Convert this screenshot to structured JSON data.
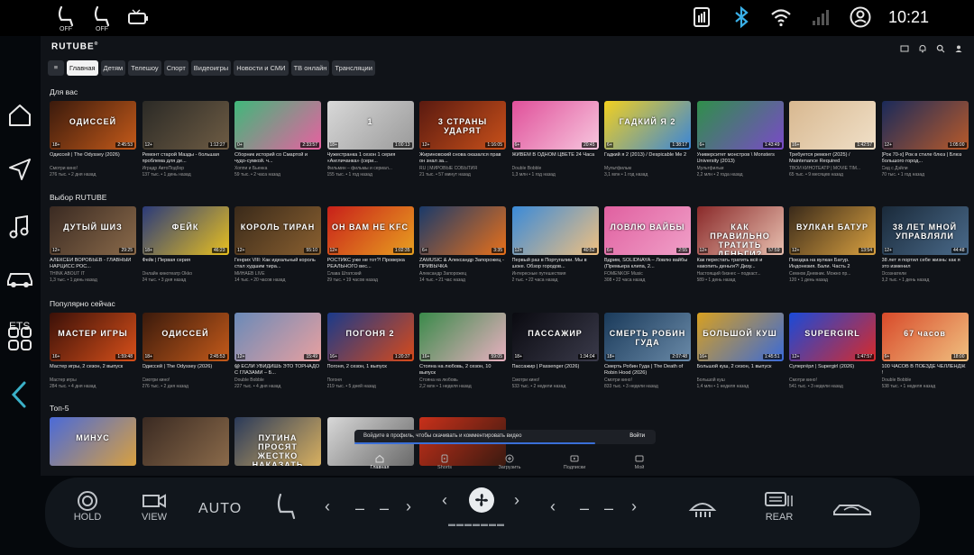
{
  "status_bar": {
    "seat_heat_left": "OFF",
    "seat_heat_right": "OFF",
    "time": "10:21"
  },
  "dock": {
    "ets_label": "ETS"
  },
  "rutube": {
    "logo": "RUTUBE",
    "categories": [
      "Главная",
      "Детям",
      "Телешоу",
      "Спорт",
      "Видеоигры",
      "Новости и СМИ",
      "ТВ онлайн",
      "Трансляции"
    ],
    "active_category": "Главная",
    "sections": [
      {
        "title": "Для вас",
        "cards": [
          {
            "title": "Одиссей | The Odyssey (2026)",
            "channel": "Смотри кино!",
            "stats": "276 тыс. • 2 дня назад",
            "age": "18+",
            "duration": "2:45:53",
            "overlay": "ОДИССЕЙ",
            "color1": "#3a1a0c",
            "color2": "#c45a1a"
          },
          {
            "title": "Ремонт старой Мазды - большая проблема для де...",
            "channel": "Иградр АвтоПодбор",
            "stats": "137 тыс. • 1 день назад",
            "age": "12+",
            "duration": "1:12:27",
            "overlay": "",
            "color1": "#2b2a26",
            "color2": "#6e5c44"
          },
          {
            "title": "Сборник историй со Смартой и чудо-сумкой. ч...",
            "channel": "Хоппи и Бьенка",
            "stats": "59 тыс. • 2 часа назад",
            "age": "0+",
            "duration": "2:33:57",
            "overlay": "",
            "color1": "#3fb87a",
            "color2": "#e860a0"
          },
          {
            "title": "Чужестранка 1 сезон 1 серия «Англичанка» (сери...",
            "channel": "Фильмин – фильмы и сериал...",
            "stats": "155 тыс. • 1 год назад",
            "age": "18+",
            "duration": "1:00:13",
            "overlay": "1",
            "color1": "#d8d8d8",
            "color2": "#9a9a9a"
          },
          {
            "title": "Жириновский снова оказался прав он знал за...",
            "channel": "RU | МИРОВЫЕ СОБЫТИЯ",
            "stats": "21 тыс. • 57 минут назад",
            "age": "12+",
            "duration": "1:16:05",
            "overlay": "3 СТРАНЫ УДАРЯТ",
            "color1": "#5a1a10",
            "color2": "#c8501a"
          },
          {
            "title": "ЖИВЕМ В ОДНОМ ЦВЕТЕ 24 Часа",
            "channel": "Double Bobble",
            "stats": "1,3 млн • 1 год назад",
            "age": "6+",
            "duration": "20:45",
            "overlay": "",
            "color1": "#e0509a",
            "color2": "#f7c6de"
          },
          {
            "title": "Гадкий я 2 (2013) / Despicable Me 2",
            "channel": "Мультфильм",
            "stats": "3,1 млн • 1 год назад",
            "age": "6+",
            "duration": "1:38:17",
            "overlay": "ГАДКИЙ Я 2",
            "color1": "#f2d020",
            "color2": "#3a86d8"
          },
          {
            "title": "Университет монстров \\ Monsters University (2013)",
            "channel": "Мультфильм",
            "stats": "2,2 млн • 2 года назад",
            "age": "6+",
            "duration": "1:43:49",
            "overlay": "",
            "color1": "#2f8f4a",
            "color2": "#7a4ac8"
          },
          {
            "title": "Требуется ремонт (2025) / Maintenance Required",
            "channel": "ТВОЙ КИНОТЕАТР | MOVIE TIM...",
            "stats": "65 тыс. • 9 месяцев назад",
            "age": "16+",
            "duration": "1:42:57",
            "overlay": "",
            "color1": "#d8b890",
            "color2": "#f0e0c8"
          },
          {
            "title": "[Рок 70-х] Рок в стиле блюз | Блюз большого город...",
            "channel": "Сид с Дэйли",
            "stats": "70 тыс. • 1 год назад",
            "age": "12+",
            "duration": "1:05:00",
            "overlay": "",
            "color1": "#1a2a5a",
            "color2": "#b85a2a"
          }
        ]
      },
      {
        "title": "Выбор RUTUBE",
        "cards": [
          {
            "title": "АЛЕКСЕЙ ВОРОБЬЁВ - ГЛАВНЫЙ НАРЦИСС РОС...",
            "channel": "THINK ABOUT IT",
            "stats": "1,3 тыс. • 1 день назад",
            "age": "12+",
            "duration": "29:25",
            "overlay": "ДУТЫЙ ШИЗ",
            "color1": "#3a2a22",
            "color2": "#8a6a4a"
          },
          {
            "title": "Фейк | Первая серия",
            "channel": "Онлайн кинотеатр Okko",
            "stats": "24 тыс. • 3 дня назад",
            "age": "18+",
            "duration": "46:23",
            "overlay": "ФЕЙК",
            "color1": "#2a3a7a",
            "color2": "#e8c020"
          },
          {
            "title": "Генрих VIII: Как идеальный король стал худшим тира...",
            "channel": "МИНАЕВ LIVE",
            "stats": "14 тыс. • 20 часов назад",
            "age": "12+",
            "duration": "55:10",
            "overlay": "КОРОЛЬ ТИРАН",
            "color1": "#3a2a1a",
            "color2": "#8a6030"
          },
          {
            "title": "РОСТИКС уже не тот?! Проверка РЕАЛЬНОГО вес...",
            "channel": "Слава Штатский",
            "stats": "29 тыс. • 19 часов назад",
            "age": "12+",
            "duration": "1:02:35",
            "overlay": "ОН ВАМ НЕ KFC",
            "color1": "#c8201a",
            "color2": "#e8a020"
          },
          {
            "title": "ZAMUSIC & Александр Запорожец - ПРИВЫЧКА",
            "channel": "Александр Запорожец",
            "stats": "14 тыс. • 21 час назад",
            "age": "6+",
            "duration": "3:35",
            "overlay": "",
            "color1": "#1a3a6a",
            "color2": "#e8701a"
          },
          {
            "title": "Первый раз в Португалии. Мы в шоке. Обзор городов...",
            "channel": "Интересные путешествия",
            "stats": "2 тыс. • 22 часа назад",
            "age": "12+",
            "duration": "40:52",
            "overlay": "",
            "color1": "#3a8ad8",
            "color2": "#f0c080"
          },
          {
            "title": "Вдрим, SOLIDNAYA – Ловлю вайбы (Премьера клипа, 2...",
            "channel": "FOMENKOF Music",
            "stats": "308 • 22 часа назад",
            "age": "6+",
            "duration": "2:55",
            "overlay": "ЛОВЛЮ ВАЙБЫ",
            "color1": "#e060a0",
            "color2": "#f0a0c8"
          },
          {
            "title": "Как перестать тратить всё и накопить деньги?! Дизу...",
            "channel": "Настоящий бизнес – подкаст...",
            "stats": "589 • 1 день назад",
            "age": "12+",
            "duration": "57:59",
            "overlay": "КАК ПРАВИЛЬНО ТРАТИТЬ ДЕНЬГИ?",
            "color1": "#8a2a2a",
            "color2": "#e8c0b0"
          },
          {
            "title": "Поездка на вулкан Батур. Индонезия. Бали. Часть 2",
            "channel": "Семнов Дневник. Можно пр...",
            "stats": "120 • 1 день назад",
            "age": "12+",
            "duration": "13:54",
            "overlay": "ВУЛКАН БАТУР",
            "color1": "#3a2a1a",
            "color2": "#d8a040"
          },
          {
            "title": "38 лет я портил себе жизнь: как я это изменил",
            "channel": "Осознатели",
            "stats": "3,2 тыс. • 1 день назад",
            "age": "12+",
            "duration": "44:48",
            "overlay": "38 ЛЕТ МНОЙ УПРАВЛЯЛИ",
            "color1": "#1a2a3a",
            "color2": "#4a6a8a"
          }
        ]
      },
      {
        "title": "Популярно сейчас",
        "cards": [
          {
            "title": "Мастер игры, 2 сезон, 2 выпуск",
            "channel": "Мастер игры",
            "stats": "284 тыс. • 4 дня назад",
            "age": "16+",
            "duration": "1:59:48",
            "overlay": "МАСТЕР ИГРЫ",
            "color1": "#3a1008",
            "color2": "#d8501a"
          },
          {
            "title": "Одиссей | The Odyssey (2026)",
            "channel": "Смотри кино!",
            "stats": "276 тыс. • 2 дня назад",
            "age": "18+",
            "duration": "2:45:53",
            "overlay": "ОДИССЕЙ",
            "color1": "#3a1a0c",
            "color2": "#c45a1a"
          },
          {
            "title": "😱 ЕСЛИ УВИДИШЬ ЭТО ТОРНАДО С ГЛАЗАМИ – Б...",
            "channel": "Double Bobble",
            "stats": "227 тыс. • 4 дня назад",
            "age": "12+",
            "duration": "15:49",
            "overlay": "",
            "color1": "#6a8ab8",
            "color2": "#e8a0a0"
          },
          {
            "title": "Погоня, 2 сезон, 1 выпуск",
            "channel": "Погоня",
            "stats": "219 тыс. • 5 дней назад",
            "age": "16+",
            "duration": "1:20:37",
            "overlay": "ПОГОНЯ 2",
            "color1": "#1a3a8a",
            "color2": "#d84a1a"
          },
          {
            "title": "Стояна на любовь, 2 сезон, 10 выпуск",
            "channel": "Стояна на любовь",
            "stats": "2,2 млн • 1 неделя назад",
            "age": "16+",
            "duration": "59:05",
            "overlay": "",
            "color1": "#3a8a4a",
            "color2": "#e8b0c0"
          },
          {
            "title": "Пассажир | Passenger (2026)",
            "channel": "Смотри кино!",
            "stats": "533 тыс. • 2 недели назад",
            "age": "18+",
            "duration": "1:34:04",
            "overlay": "ПАССАЖИР",
            "color1": "#0a0a10",
            "color2": "#3a3a4a"
          },
          {
            "title": "Смерть Робин Гуда | The Death of Robin Hood (2026)",
            "channel": "Смотри кино!",
            "stats": "833 тыс. • 3 недели назад",
            "age": "18+",
            "duration": "2:07:48",
            "overlay": "СМЕРТЬ РОБИН ГУДА",
            "color1": "#1a3a5a",
            "color2": "#6a8aa8"
          },
          {
            "title": "Большой куш, 2 сезон, 1 выпуск",
            "channel": "Большой куш",
            "stats": "1,4 млн • 1 неделя назад",
            "age": "16+",
            "duration": "1:45:51",
            "overlay": "БОЛЬШОЙ КУШ",
            "color1": "#d8a020",
            "color2": "#3a6ad8"
          },
          {
            "title": "Супергёрл | Supergirl (2026)",
            "channel": "Смотри кино!",
            "stats": "541 тыс. • 3 недели назад",
            "age": "12+",
            "duration": "1:47:57",
            "overlay": "SUPERGIRL",
            "color1": "#1a4ad8",
            "color2": "#d82a2a"
          },
          {
            "title": "100 ЧАСОВ В ПОЕЗДЕ ЧЕЛЛЕНДЖ !",
            "channel": "Double Bobble",
            "stats": "538 тыс. • 1 неделя назад",
            "age": "6+",
            "duration": "18:00",
            "overlay": "67 часов",
            "color1": "#d84a2a",
            "color2": "#f0c080"
          }
        ]
      },
      {
        "title": "Топ-5",
        "cards": [
          {
            "title": "",
            "channel": "",
            "stats": "",
            "age": "",
            "duration": "",
            "overlay": "МИНУС",
            "color1": "#4a6ad8",
            "color2": "#d8a040"
          },
          {
            "title": "",
            "channel": "",
            "stats": "",
            "age": "",
            "duration": "",
            "overlay": "",
            "color1": "#3a2a22",
            "color2": "#8a6a4a"
          },
          {
            "title": "",
            "channel": "",
            "stats": "",
            "age": "",
            "duration": "",
            "overlay": "ПУТИНА ПРОСЯТ ЖЕСТКО НАКАЗАТЬ НАТО",
            "color1": "#2a3a5a",
            "color2": "#d8b060"
          },
          {
            "title": "",
            "channel": "",
            "stats": "",
            "age": "",
            "duration": "",
            "overlay": "",
            "color1": "#d8d8d8",
            "color2": "#6a6a6a"
          },
          {
            "title": "",
            "channel": "",
            "stats": "",
            "age": "",
            "duration": "",
            "overlay": "",
            "color1": "#c8301a",
            "color2": "#3a1a10"
          }
        ]
      }
    ],
    "toast": {
      "message": "Войдите в профиль, чтобы скачивать и комментировать видео",
      "action": "Войти",
      "progress": 0.8
    },
    "bottom_nav": [
      {
        "label": "Главная",
        "active": true
      },
      {
        "label": "Shorts",
        "active": false
      },
      {
        "label": "Загрузить",
        "active": false
      },
      {
        "label": "Подписки",
        "active": false
      },
      {
        "label": "Мой",
        "active": false
      }
    ]
  },
  "climate": {
    "hold_label": "HOLD",
    "view_label": "VIEW",
    "auto_label": "AUTO",
    "left_temp": "– –",
    "right_temp": "– –",
    "fan_level_dots": "▬▬▬▬▬▬▬",
    "rear_label": "REAR"
  }
}
